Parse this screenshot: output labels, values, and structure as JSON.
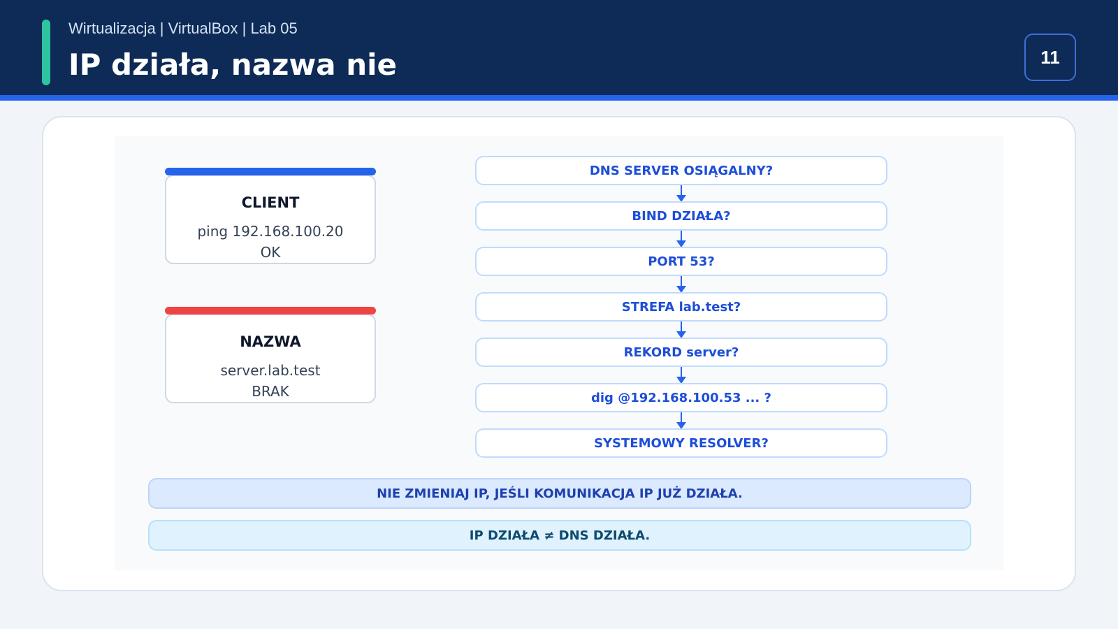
{
  "header": {
    "subtitle": "Wirtualizacja | VirtualBox | Lab 05",
    "title": "IP działa, nazwa nie",
    "page_number": "11"
  },
  "colors": {
    "header_bg": "#0d2b56",
    "accent": "#2ec4a0",
    "blue": "#2563eb",
    "red": "#ef4444"
  },
  "client_box": {
    "name": "CLIENT",
    "line1": "ping 192.168.100.20",
    "line2": "OK"
  },
  "name_box": {
    "name": "NAZWA",
    "line1": "server.lab.test",
    "line2": "BRAK"
  },
  "steps": [
    "DNS SERVER OSIĄGALNY?",
    "BIND DZIAŁA?",
    "PORT 53?",
    "STREFA lab.test?",
    "REKORD server?",
    "dig @192.168.100.53 ... ?",
    "SYSTEMOWY RESOLVER?"
  ],
  "notes": {
    "warning": "NIE ZMIENIAJ IP, JEŚLI KOMUNIKACJA IP JUŻ DZIAŁA.",
    "summary": "IP DZIAŁA ≠ DNS DZIAŁA."
  }
}
